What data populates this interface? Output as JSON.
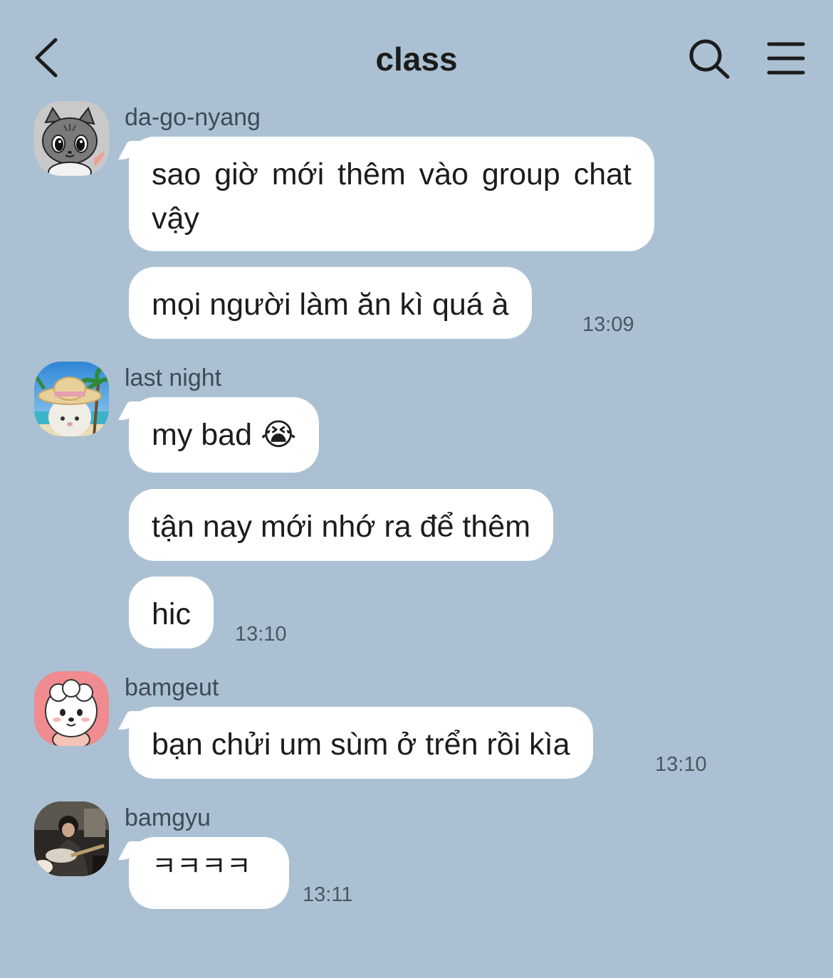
{
  "header": {
    "title": "class"
  },
  "icons": {
    "back": "chevron-left-icon",
    "search": "search-icon",
    "menu": "hamburger-menu-icon"
  },
  "messages": [
    {
      "sender": "da-go-nyang",
      "avatar": "gray-cat-avatar",
      "bubbles": [
        "sao giờ mới thêm vào group chat vậy",
        "mọi người làm ăn kì quá à"
      ],
      "time": "13:09"
    },
    {
      "sender": "last night",
      "avatar": "straw-hat-cat-beach-avatar",
      "bubbles": [
        "my bad 😭",
        "tận nay mới nhớ ra để thêm",
        "hic"
      ],
      "time": "13:10"
    },
    {
      "sender": "bamgeut",
      "avatar": "white-puppy-pink-avatar",
      "bubbles": [
        "bạn chửi um sùm ở trển rồi kìa"
      ],
      "time": "13:10"
    },
    {
      "sender": "bamgyu",
      "avatar": "guitar-player-photo-avatar",
      "bubbles": [
        "ㅋㅋㅋㅋ"
      ],
      "time": "13:11"
    }
  ],
  "colors": {
    "background": "#abc1d3",
    "bubble": "#ffffff",
    "text": "#1c1c1c",
    "sender_text": "#3f4a55",
    "time_text": "#4c5660"
  }
}
